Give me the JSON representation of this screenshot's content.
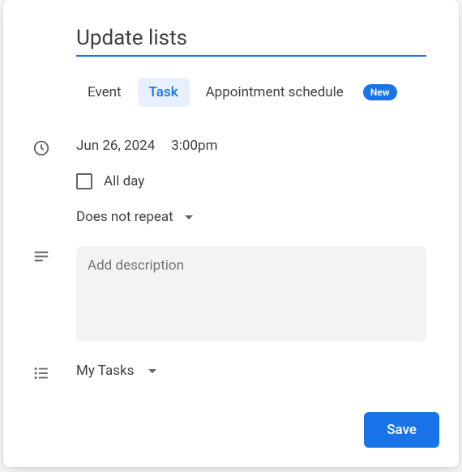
{
  "title": "Update lists",
  "tabs": {
    "event": "Event",
    "task": "Task",
    "appointment": "Appointment schedule",
    "new_badge": "New",
    "active": "task"
  },
  "datetime": {
    "date": "Jun 26, 2024",
    "time": "3:00pm"
  },
  "allday": {
    "label": "All day",
    "checked": false
  },
  "repeat": {
    "label": "Does not repeat"
  },
  "description": {
    "placeholder": "Add description",
    "value": ""
  },
  "tasklist": {
    "label": "My Tasks"
  },
  "buttons": {
    "save": "Save"
  }
}
